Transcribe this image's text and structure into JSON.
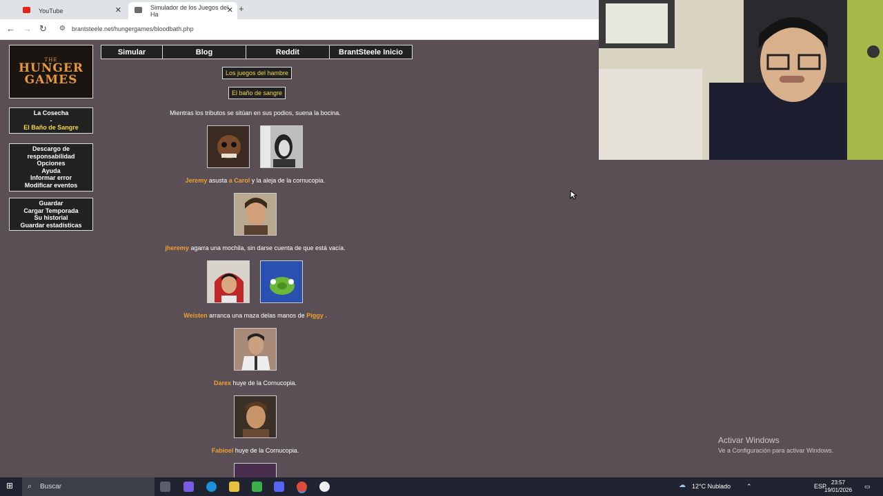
{
  "browser": {
    "tabs": [
      {
        "title": "YouTube",
        "active": false
      },
      {
        "title": "Simulador de los Juegos del Ha",
        "active": true
      }
    ],
    "url": "brantsteele.net/hungergames/bloodbath.php"
  },
  "logo": {
    "line1": "THE",
    "line2": "HUNGER",
    "line3": "GAMES"
  },
  "sidebar": {
    "box1": [
      "La Cosecha",
      "-",
      "El Baño de Sangre"
    ],
    "box2": [
      "Descargo de responsabilidad",
      "Opciones",
      "Ayuda",
      "Informar error",
      "Modificar eventos"
    ],
    "box3": [
      "Guardar",
      "Cargar Temporada",
      "Su historial",
      "Guardar estadísticas"
    ]
  },
  "nav": [
    "Simular",
    "Blog",
    "Reddit",
    "BrantSteele Inicio"
  ],
  "headings": {
    "title": "Los juegos del hambre",
    "subtitle": "El baño de sangre"
  },
  "intro": "Mientras los tributos se sitúan en sus podios, suena la bocina.",
  "events": [
    {
      "parts": [
        {
          "t": "Jeremy",
          "n": true
        },
        {
          "t": " asusta ",
          "n": false
        },
        {
          "t": "a Carol",
          "n": true
        },
        {
          "t": " y la aleja de la cornucopia.",
          "n": false
        }
      ]
    },
    {
      "parts": [
        {
          "t": "jheremy",
          "n": true
        },
        {
          "t": " agarra una mochila, sin darse cuenta de que está vacía.",
          "n": false
        }
      ]
    },
    {
      "parts": [
        {
          "t": "Weisten",
          "n": true
        },
        {
          "t": " arranca una maza delas manos de ",
          "n": false
        },
        {
          "t": "Piggy .",
          "n": true
        }
      ]
    },
    {
      "parts": [
        {
          "t": "Darex",
          "n": true
        },
        {
          "t": " huye de la Cornucopia.",
          "n": false
        }
      ]
    },
    {
      "parts": [
        {
          "t": "Fabioel",
          "n": true
        },
        {
          "t": " huye de la Cornucopia.",
          "n": false
        }
      ]
    }
  ],
  "watermark": {
    "line1": "Activar Windows",
    "line2": "Ve a Configuración para activar Windows."
  },
  "taskbar": {
    "search": "Buscar",
    "weather": "12°C Nublado",
    "lang": "ESP",
    "time": "23:57",
    "date": "19/01/2026"
  }
}
